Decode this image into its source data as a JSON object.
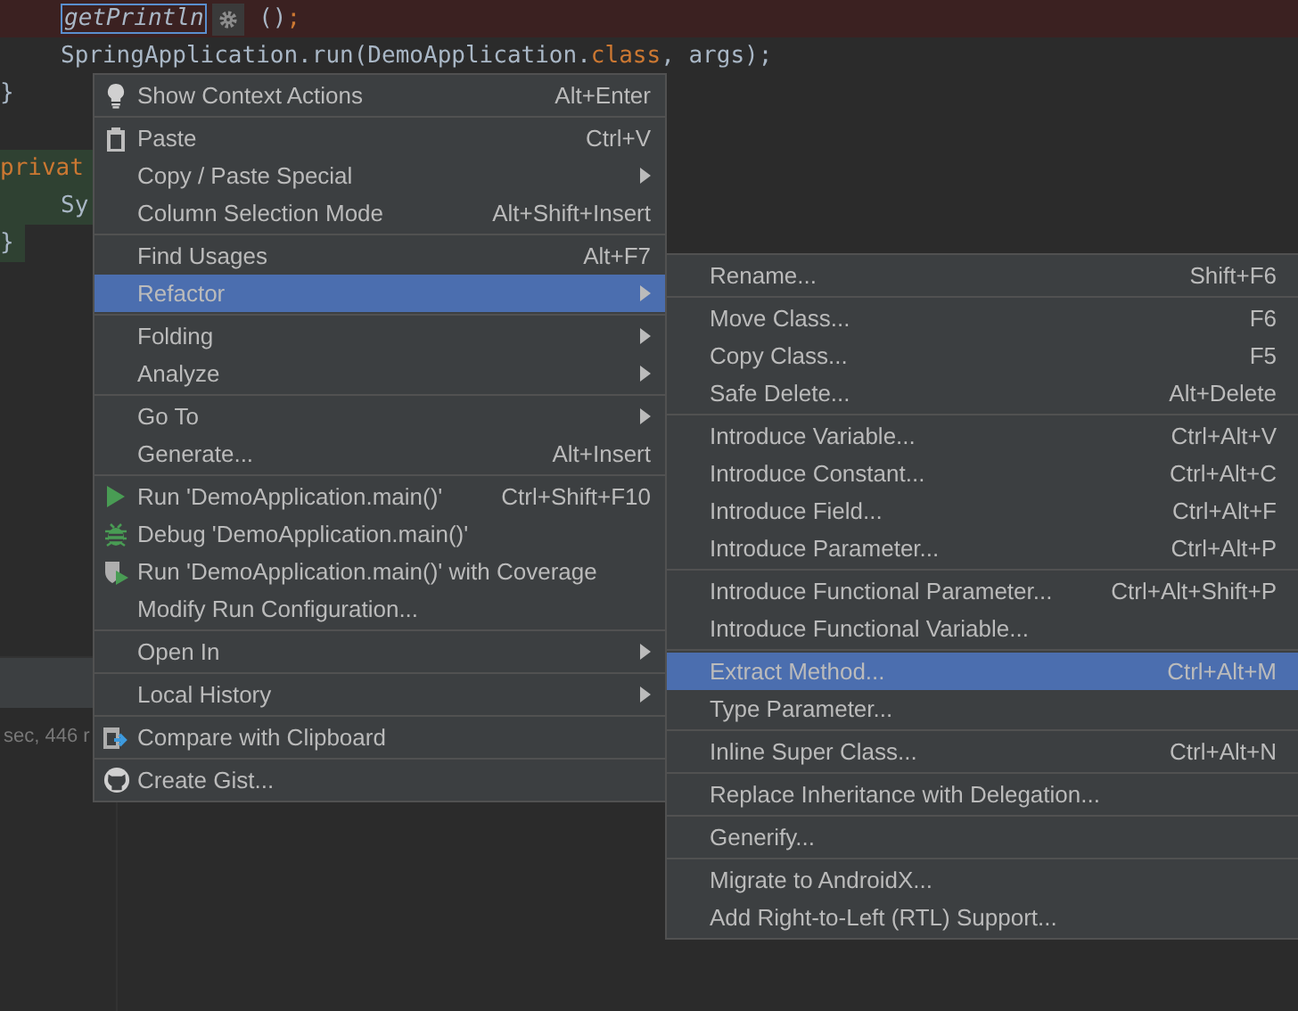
{
  "editor": {
    "lines": [
      {
        "kind": "error",
        "indent": true,
        "segments": [
          {
            "kind": "italic-boxed",
            "text": "getPrintln"
          },
          {
            "kind": "gear"
          },
          {
            "kind": "plain",
            "text": " ()"
          },
          {
            "kind": "keyword",
            "text": ";"
          }
        ]
      },
      {
        "kind": "plain",
        "indent": true,
        "segments": [
          {
            "kind": "plain",
            "text": "SpringApplication.run(DemoApplication."
          },
          {
            "kind": "keyword",
            "text": "class"
          },
          {
            "kind": "plain",
            "text": ", args);"
          }
        ]
      },
      {
        "kind": "plain",
        "indent": false,
        "segments": [
          {
            "kind": "plain",
            "text": "}"
          }
        ]
      },
      {
        "kind": "blank"
      },
      {
        "kind": "green",
        "indent": false,
        "segments": [
          {
            "kind": "keyword",
            "text": "privat"
          }
        ]
      },
      {
        "kind": "green",
        "indent": true,
        "segments": [
          {
            "kind": "plain",
            "text": "Sy"
          }
        ]
      },
      {
        "kind": "green-short",
        "indent": false,
        "segments": [
          {
            "kind": "plain",
            "text": "}"
          }
        ]
      }
    ]
  },
  "status_text": "sec, 446 r",
  "context_menu": {
    "groups": [
      [
        {
          "label": "Show Context Actions",
          "shortcut": "Alt+Enter",
          "kind": "bulb",
          "submenu": false,
          "selected": false
        }
      ],
      [
        {
          "label": "Paste",
          "shortcut": "Ctrl+V",
          "kind": "clipboard",
          "submenu": false,
          "selected": false
        },
        {
          "label": "Copy / Paste Special",
          "kind": "text",
          "submenu": true,
          "selected": false
        },
        {
          "label": "Column Selection Mode",
          "shortcut": "Alt+Shift+Insert",
          "kind": "text",
          "submenu": false,
          "selected": false
        }
      ],
      [
        {
          "label": "Find Usages",
          "shortcut": "Alt+F7",
          "kind": "text",
          "submenu": false,
          "selected": false
        },
        {
          "label": "Refactor",
          "kind": "text",
          "submenu": true,
          "selected": true
        }
      ],
      [
        {
          "label": "Folding",
          "kind": "text",
          "submenu": true,
          "selected": false
        },
        {
          "label": "Analyze",
          "kind": "text",
          "submenu": true,
          "selected": false
        }
      ],
      [
        {
          "label": "Go To",
          "kind": "text",
          "submenu": true,
          "selected": false
        },
        {
          "label": "Generate...",
          "shortcut": "Alt+Insert",
          "kind": "text",
          "submenu": false,
          "selected": false
        }
      ],
      [
        {
          "label": "Run 'DemoApplication.main()'",
          "shortcut": "Ctrl+Shift+F10",
          "kind": "run",
          "submenu": false,
          "selected": false
        },
        {
          "label": "Debug 'DemoApplication.main()'",
          "kind": "debug",
          "submenu": false,
          "selected": false
        },
        {
          "label": "Run 'DemoApplication.main()' with Coverage",
          "kind": "coverage",
          "submenu": false,
          "selected": false
        },
        {
          "label": "Modify Run Configuration...",
          "kind": "text",
          "submenu": false,
          "selected": false
        }
      ],
      [
        {
          "label": "Open In",
          "kind": "text",
          "submenu": true,
          "selected": false
        }
      ],
      [
        {
          "label": "Local History",
          "kind": "text",
          "submenu": true,
          "selected": false
        }
      ],
      [
        {
          "label": "Compare with Clipboard",
          "kind": "compare",
          "submenu": false,
          "selected": false
        }
      ],
      [
        {
          "label": "Create Gist...",
          "kind": "gist",
          "submenu": false,
          "selected": false
        }
      ]
    ]
  },
  "refactor_menu": {
    "groups": [
      [
        {
          "label": "Rename...",
          "shortcut": "Shift+F6",
          "selected": false
        }
      ],
      [
        {
          "label": "Move Class...",
          "shortcut": "F6",
          "selected": false
        },
        {
          "label": "Copy Class...",
          "shortcut": "F5",
          "selected": false
        },
        {
          "label": "Safe Delete...",
          "shortcut": "Alt+Delete",
          "selected": false
        }
      ],
      [
        {
          "label": "Introduce Variable...",
          "shortcut": "Ctrl+Alt+V",
          "selected": false
        },
        {
          "label": "Introduce Constant...",
          "shortcut": "Ctrl+Alt+C",
          "selected": false
        },
        {
          "label": "Introduce Field...",
          "shortcut": "Ctrl+Alt+F",
          "selected": false
        },
        {
          "label": "Introduce Parameter...",
          "shortcut": "Ctrl+Alt+P",
          "selected": false
        }
      ],
      [
        {
          "label": "Introduce Functional Parameter...",
          "shortcut": "Ctrl+Alt+Shift+P",
          "selected": false
        },
        {
          "label": "Introduce Functional Variable...",
          "selected": false
        }
      ],
      [
        {
          "label": "Extract Method...",
          "shortcut": "Ctrl+Alt+M",
          "selected": true
        },
        {
          "label": "Type Parameter...",
          "selected": false
        }
      ],
      [
        {
          "label": "Inline Super Class...",
          "shortcut": "Ctrl+Alt+N",
          "selected": false
        }
      ],
      [
        {
          "label": "Replace Inheritance with Delegation...",
          "selected": false
        }
      ],
      [
        {
          "label": "Generify...",
          "selected": false
        }
      ],
      [
        {
          "label": "Migrate to AndroidX...",
          "selected": false
        },
        {
          "label": "Add Right-to-Left (RTL) Support...",
          "selected": false
        }
      ]
    ]
  }
}
